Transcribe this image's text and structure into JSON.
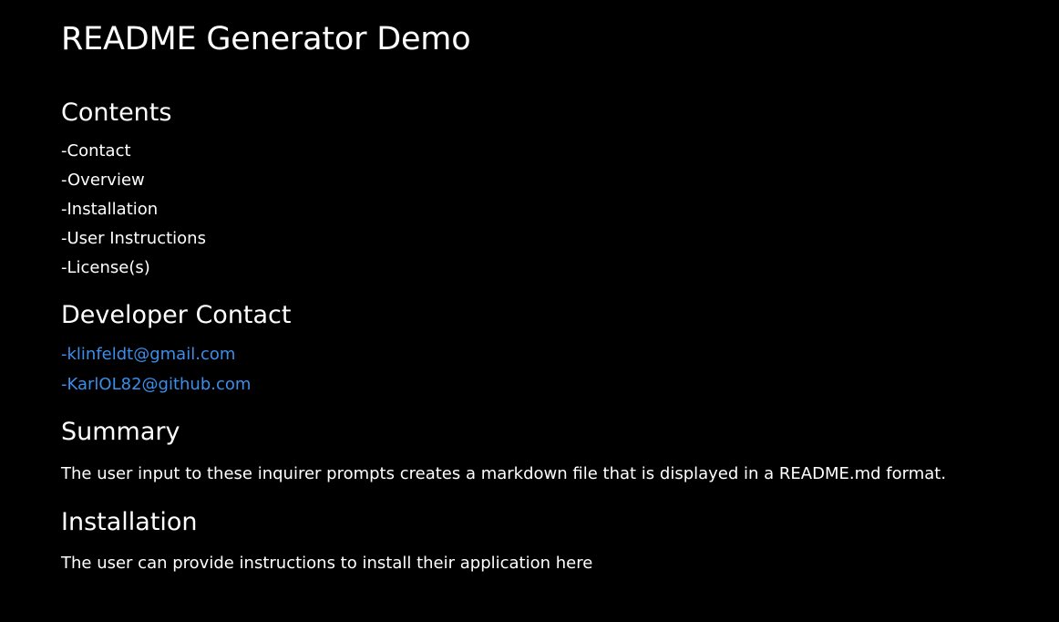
{
  "title": "README Generator Demo",
  "contents": {
    "heading": "Contents",
    "items": [
      "-Contact",
      "-Overview",
      "-Installation",
      "-User Instructions",
      "-License(s)"
    ]
  },
  "contact": {
    "heading": "Developer Contact",
    "links": [
      "-klinfeldt@gmail.com",
      "-KarlOL82@github.com"
    ]
  },
  "summary": {
    "heading": "Summary",
    "text": "The user input to these inquirer prompts creates a markdown file that is displayed in a README.md format."
  },
  "installation": {
    "heading": "Installation",
    "text": "The user can provide instructions to install their application here"
  },
  "colors": {
    "background": "#000000",
    "text": "#ffffff",
    "link": "#3b8eea"
  }
}
